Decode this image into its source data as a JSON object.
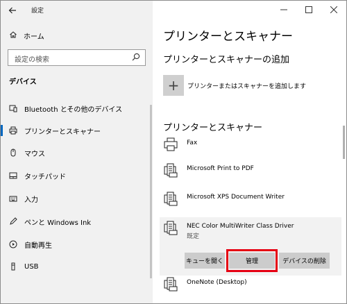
{
  "window": {
    "title": "設定",
    "back_icon": "arrow-left-icon",
    "controls": [
      "minimize-icon",
      "maximize-icon",
      "close-icon"
    ]
  },
  "sidebar": {
    "home_label": "ホーム",
    "search_placeholder": "設定の検索",
    "section_title": "デバイス",
    "items": [
      {
        "label": "Bluetooth とその他のデバイス",
        "icon": "bluetooth-devices-icon"
      },
      {
        "label": "プリンターとスキャナー",
        "icon": "printer-icon",
        "selected": true
      },
      {
        "label": "マウス",
        "icon": "mouse-icon"
      },
      {
        "label": "タッチパッド",
        "icon": "touchpad-icon"
      },
      {
        "label": "入力",
        "icon": "keyboard-icon"
      },
      {
        "label": "ペンと Windows Ink",
        "icon": "pen-icon"
      },
      {
        "label": "自動再生",
        "icon": "autoplay-icon"
      },
      {
        "label": "USB",
        "icon": "usb-icon"
      }
    ]
  },
  "main": {
    "title": "プリンターとスキャナー",
    "add_section_title": "プリンターとスキャナーの追加",
    "add_label": "プリンターまたはスキャナーを追加します",
    "list_title": "プリンターとスキャナー",
    "printers": [
      {
        "name": "Fax",
        "status": ""
      },
      {
        "name": "Microsoft Print to PDF",
        "status": ""
      },
      {
        "name": "Microsoft XPS Document Writer",
        "status": ""
      },
      {
        "name": "NEC Color MultiWriter Class Driver",
        "status": "既定",
        "selected": true
      },
      {
        "name": "OneNote (Desktop)",
        "status": ""
      }
    ],
    "actions": {
      "open_queue": "キューを開く",
      "manage": "管理",
      "remove": "デバイスの削除"
    },
    "highlight_color": "#e60012"
  }
}
